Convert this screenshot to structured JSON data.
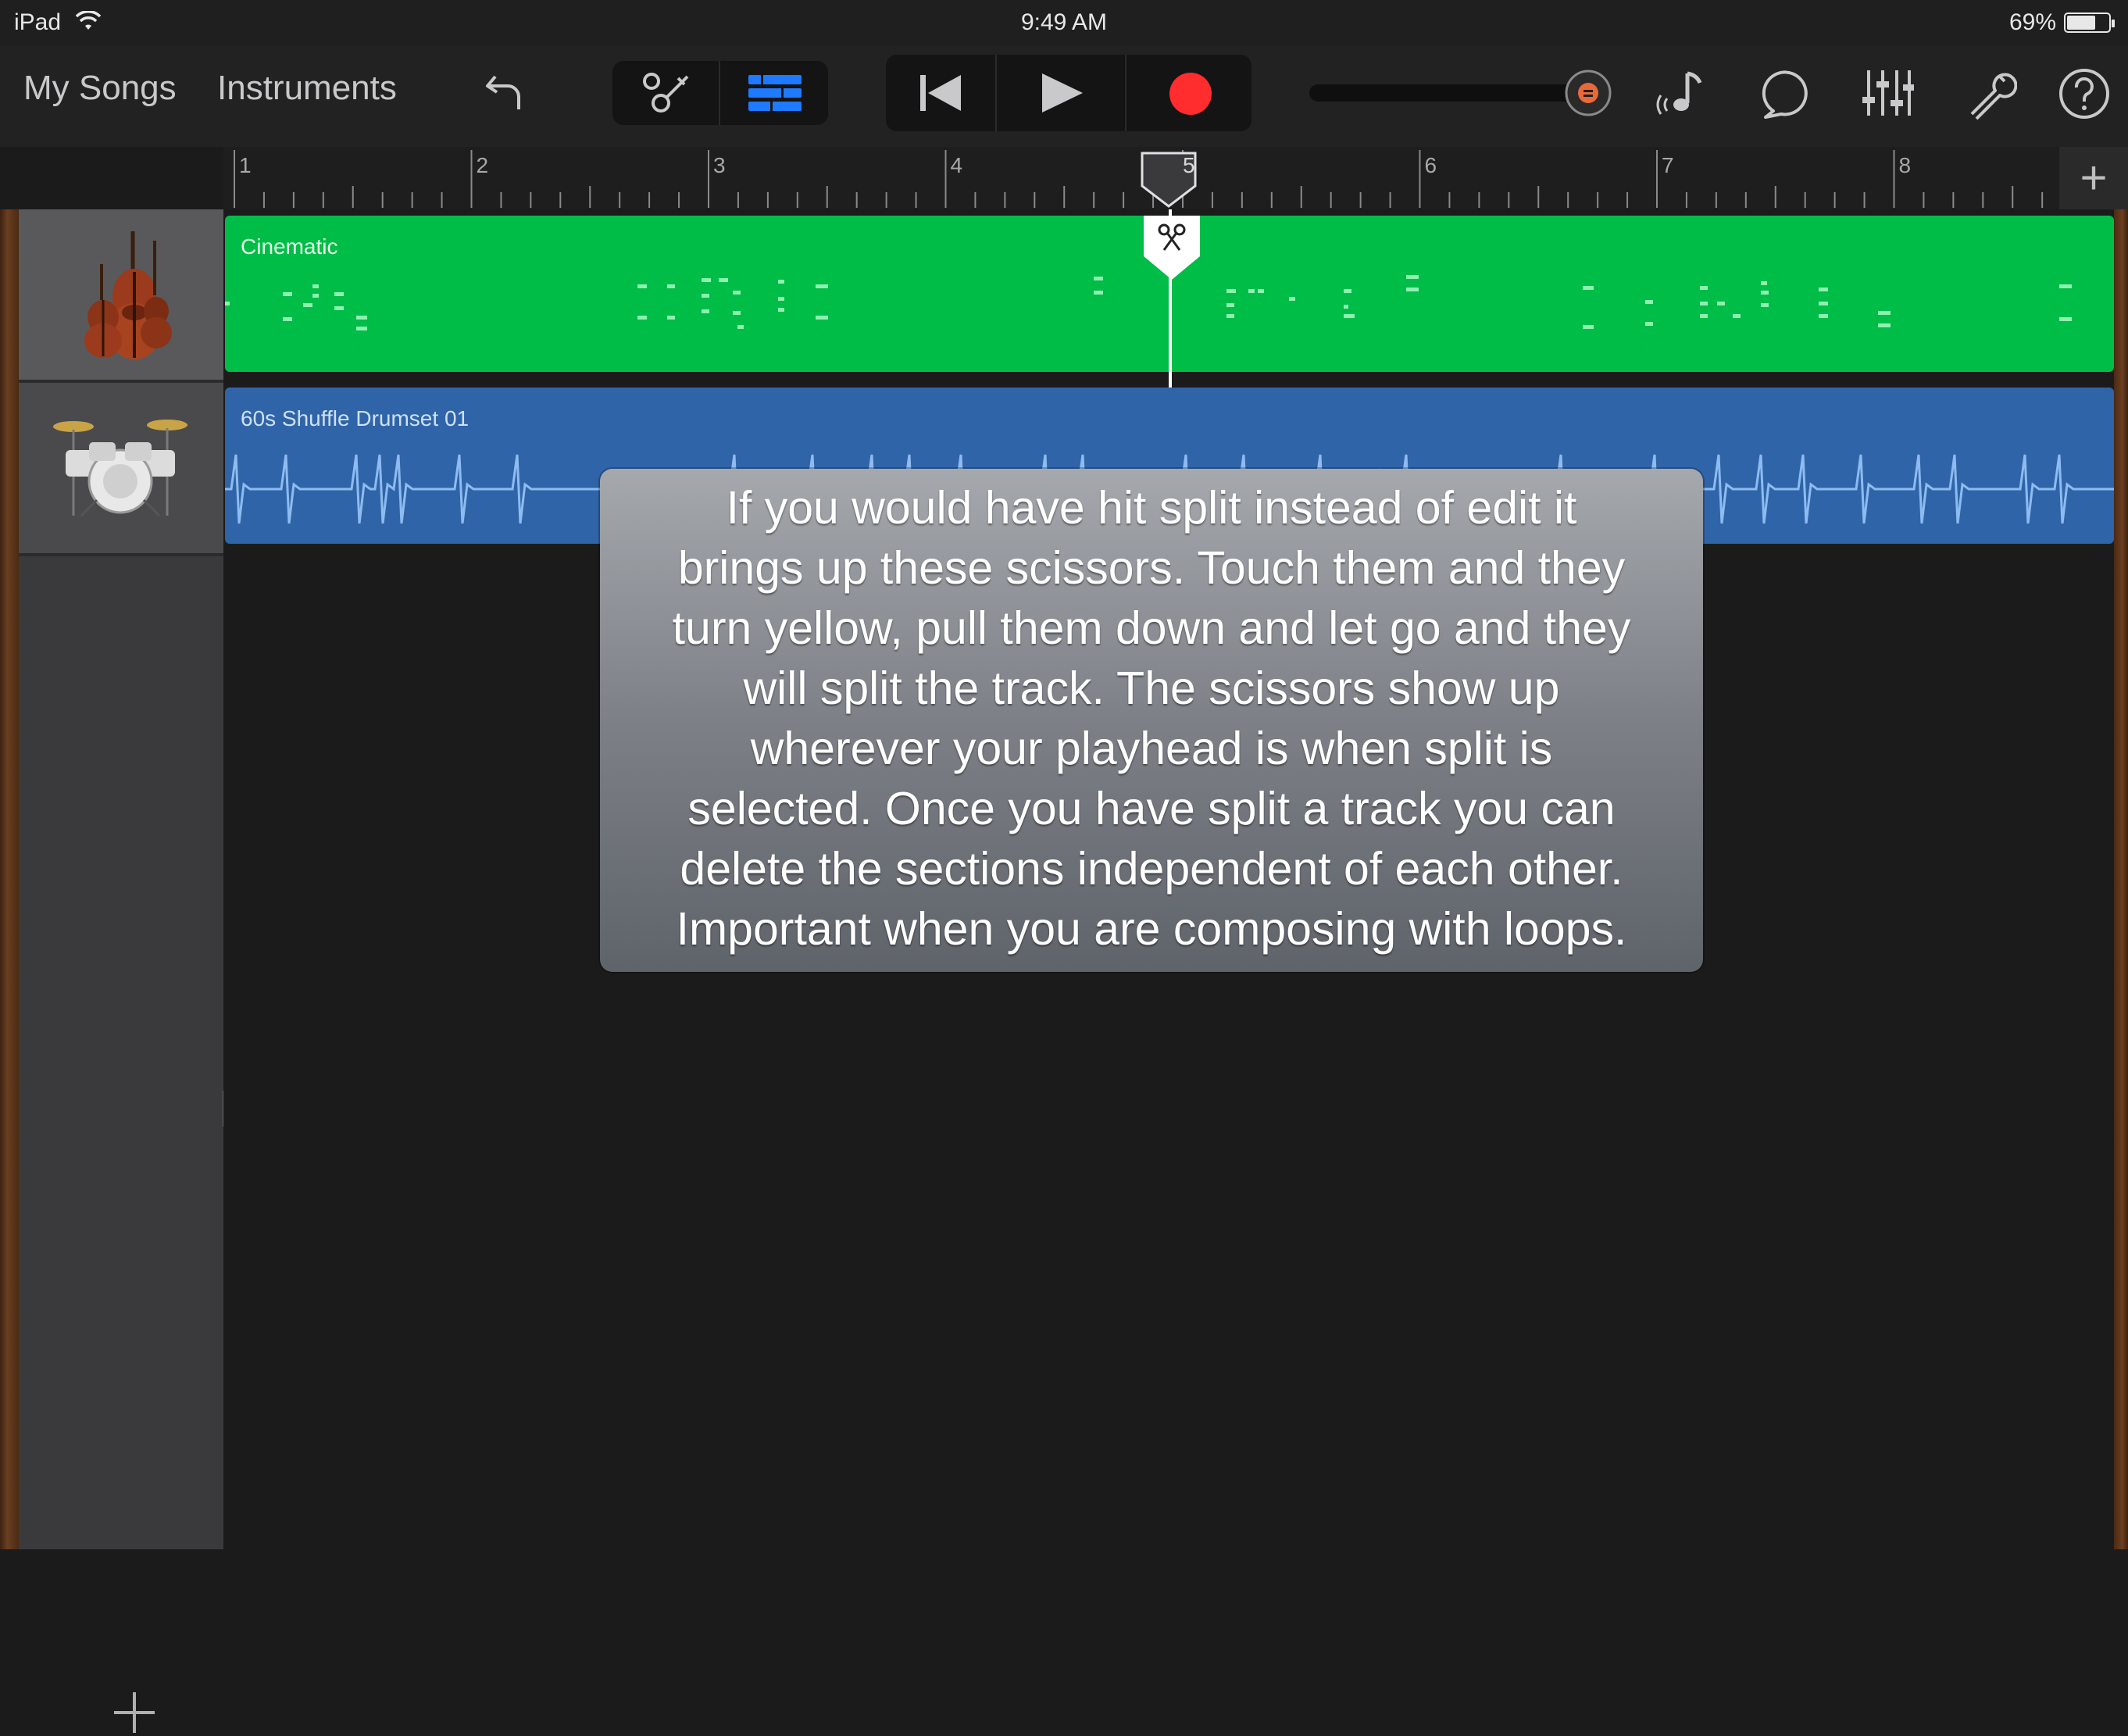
{
  "status_bar": {
    "device": "iPad",
    "time": "9:49 AM",
    "battery_percent": "69%",
    "battery_level": 0.69
  },
  "toolbar": {
    "my_songs": "My Songs",
    "instruments": "Instruments",
    "icons": [
      "undo-icon",
      "browser-icon",
      "tracks-view-icon",
      "rewind-icon",
      "play-icon",
      "record-icon",
      "master-volume-slider",
      "metronome-icon",
      "loop-browser-icon",
      "mixer-icon",
      "settings-wrench-icon",
      "help-icon"
    ],
    "record_color": "#ff2d2d",
    "active_color": "#1e7bff"
  },
  "ruler": {
    "bars": [
      "1",
      "2",
      "3",
      "4",
      "5",
      "6",
      "7",
      "8"
    ],
    "playhead_bar": "5"
  },
  "tracks": [
    {
      "name": "Cinematic",
      "instrument_icon": "strings-instrument-icon",
      "color": "#00bd48"
    },
    {
      "name": "60s Shuffle Drumset 01",
      "instrument_icon": "drumkit-icon",
      "color": "#2f64a8"
    }
  ],
  "callout": {
    "lines": [
      "If you would have hit split instead of edit it",
      "brings up these scissors.  Touch them and they",
      "turn yellow, pull them down and let go and they",
      "will split the track.  The scissors show up",
      "wherever your playhead is when split is",
      "selected.  Once you have split a track you can",
      "delete the sections independent of each other.",
      "Important when you are composing with loops."
    ]
  }
}
